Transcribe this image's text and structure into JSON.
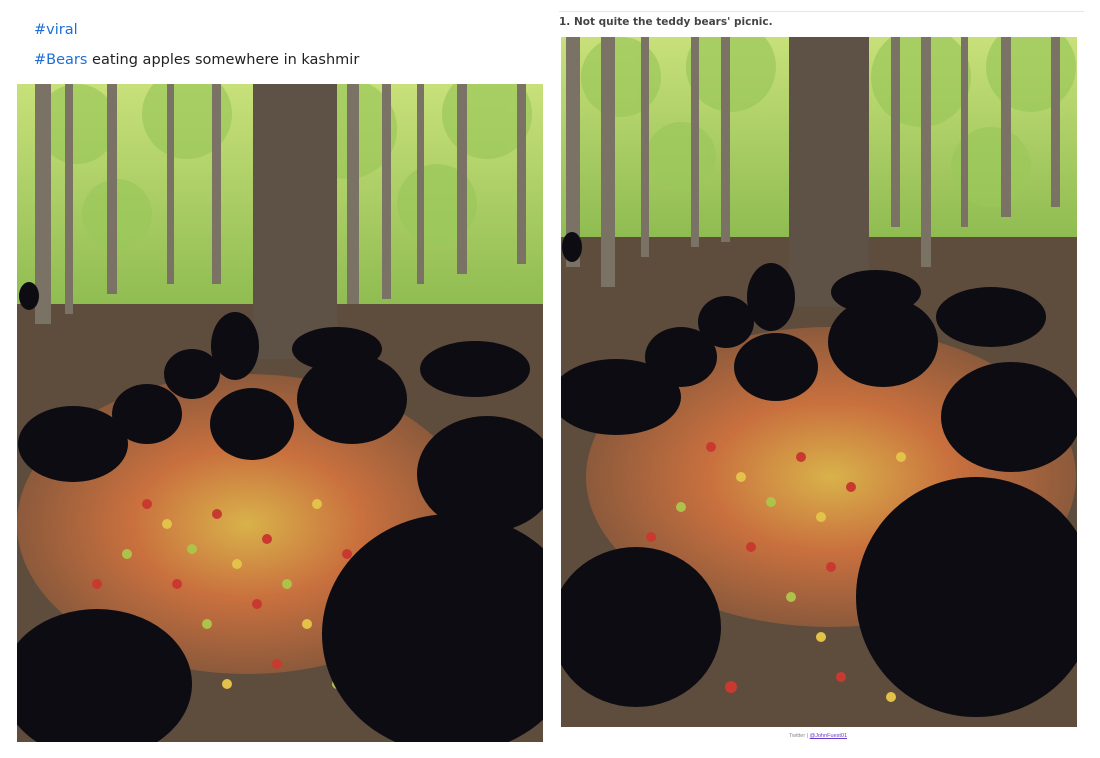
{
  "left_post": {
    "line1_hashtag": "#viral",
    "line2_hashtag": "#Bears",
    "line2_text": " eating apples somewhere in kashmir",
    "photo_alt": "Bears eating apples"
  },
  "right_post": {
    "heading": "1. Not quite the teddy bears' picnic.",
    "credit_prefix": "Twitter | ",
    "credit_handle": "@JohnFuest01",
    "photo_alt": "Bears eating apples in forest"
  },
  "colors": {
    "hashtag": "#1d6fd8",
    "bear": "#0c0c12",
    "apple_red": "#c83a30",
    "apple_yellow": "#e3c24a",
    "apple_green": "#aec24a",
    "forest_green": "#7fb24a",
    "ground": "#5b4a3c"
  }
}
